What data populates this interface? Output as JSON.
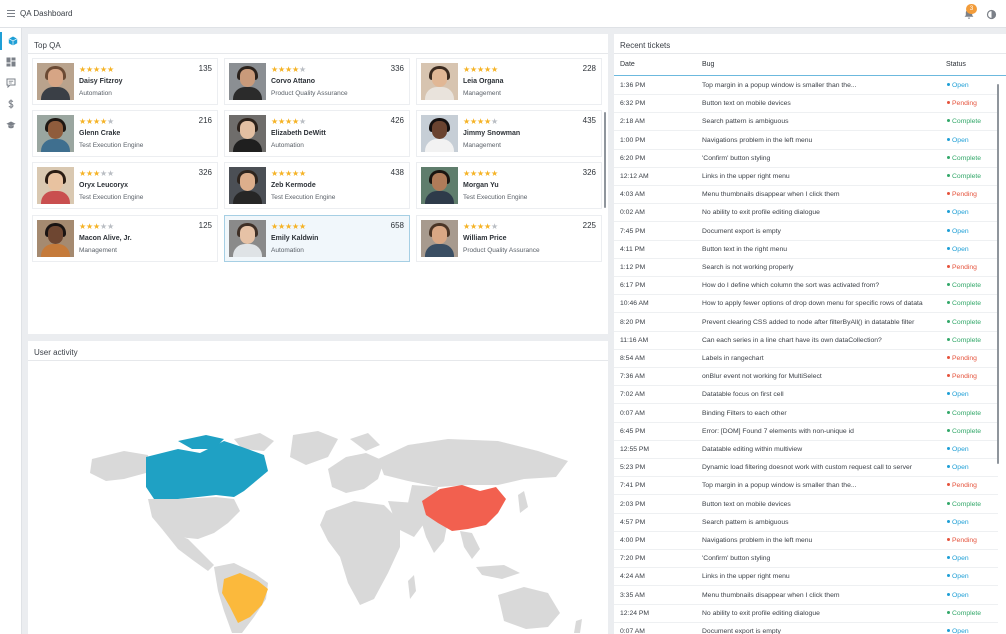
{
  "app": {
    "title": "QA Dashboard",
    "notifications": "3"
  },
  "colors": {
    "open": "#1f9fd6",
    "pending": "#e5533c",
    "complete": "#33a86a",
    "star": "#f5b326"
  },
  "sidenav": {
    "items": [
      {
        "name": "nav-dashboard",
        "icon": "cube-icon",
        "active": true
      },
      {
        "name": "nav-widgets",
        "icon": "grid-icon"
      },
      {
        "name": "nav-messages",
        "icon": "message-icon"
      },
      {
        "name": "nav-finance",
        "icon": "dollar-icon"
      },
      {
        "name": "nav-education",
        "icon": "graduation-cap-icon"
      }
    ]
  },
  "top_qa": {
    "title": "Top QA",
    "cards": [
      {
        "name": "Daisy Fitzroy",
        "role": "Automation",
        "count": "135",
        "rating": 5
      },
      {
        "name": "Corvo Attano",
        "role": "Product Quality Assurance",
        "count": "336",
        "rating": 4
      },
      {
        "name": "Leia Organa",
        "role": "Management",
        "count": "228",
        "rating": 5
      },
      {
        "name": "Glenn Crake",
        "role": "Test Execution Engine",
        "count": "216",
        "rating": 4
      },
      {
        "name": "Elizabeth DeWitt",
        "role": "Automation",
        "count": "426",
        "rating": 4
      },
      {
        "name": "Jimmy Snowman",
        "role": "Management",
        "count": "435",
        "rating": 4
      },
      {
        "name": "Oryx Leucoryx",
        "role": "Test Execution Engine",
        "count": "326",
        "rating": 3
      },
      {
        "name": "Zeb Kermode",
        "role": "Test Execution Engine",
        "count": "438",
        "rating": 5
      },
      {
        "name": "Morgan Yu",
        "role": "Test Execution Engine",
        "count": "326",
        "rating": 5
      },
      {
        "name": "Macon Alive, Jr.",
        "role": "Management",
        "count": "125",
        "rating": 3
      },
      {
        "name": "Emily Kaldwin",
        "role": "Automation",
        "count": "658",
        "rating": 5,
        "selected": true
      },
      {
        "name": "William Price",
        "role": "Product Quality Assurance",
        "count": "225",
        "rating": 4
      }
    ]
  },
  "user_activity": {
    "title": "User activity",
    "highlighted_countries": [
      "Canada",
      "China",
      "Brazil"
    ]
  },
  "tickets": {
    "title": "Recent tickets",
    "columns": [
      "Date",
      "Bug",
      "Status"
    ],
    "rows": [
      {
        "date": "1:36 PM",
        "bug": "Top margin in a popup window is smaller than the...",
        "status": "Open"
      },
      {
        "date": "6:32 PM",
        "bug": "Button text on mobile devices",
        "status": "Pending"
      },
      {
        "date": "2:18 AM",
        "bug": "Search pattern is ambiguous",
        "status": "Complete"
      },
      {
        "date": "1:00 PM",
        "bug": "Navigations problem in the left menu",
        "status": "Open"
      },
      {
        "date": "6:20 PM",
        "bug": "'Confirm' button styling",
        "status": "Complete"
      },
      {
        "date": "12:12 AM",
        "bug": "Links in the upper right menu",
        "status": "Complete"
      },
      {
        "date": "4:03 AM",
        "bug": "Menu thumbnails disappear when I click them",
        "status": "Pending"
      },
      {
        "date": "0:02 AM",
        "bug": "No ability to exit profile editing dialogue",
        "status": "Open"
      },
      {
        "date": "7:45 PM",
        "bug": "Document export is empty",
        "status": "Open"
      },
      {
        "date": "4:11 PM",
        "bug": "Button text in the right menu",
        "status": "Open"
      },
      {
        "date": "1:12 PM",
        "bug": "Search is not working properly",
        "status": "Pending"
      },
      {
        "date": "6:17 PM",
        "bug": "How do I define which column the sort was activated from?",
        "status": "Complete"
      },
      {
        "date": "10:46 AM",
        "bug": "How to apply fewer options of drop down menu for specific rows of datata",
        "status": "Complete"
      },
      {
        "date": "8:20 PM",
        "bug": "Prevent clearing CSS added to node after filterByAll() in datatable filter",
        "status": "Complete"
      },
      {
        "date": "11:16 AM",
        "bug": "Can each series in a line chart have its own dataCollection?",
        "status": "Complete"
      },
      {
        "date": "8:54 AM",
        "bug": "Labels in rangechart",
        "status": "Pending"
      },
      {
        "date": "7:36 AM",
        "bug": "onBlur event not working for MultiSelect",
        "status": "Pending"
      },
      {
        "date": "7:02 AM",
        "bug": "Datatable focus on first cell",
        "status": "Open"
      },
      {
        "date": "0:07 AM",
        "bug": "Binding Filters to each other",
        "status": "Complete"
      },
      {
        "date": "6:45 PM",
        "bug": "Error: [DOM] Found 7 elements with non-unique id",
        "status": "Complete"
      },
      {
        "date": "12:55 PM",
        "bug": "Datatable editing within multiview",
        "status": "Open"
      },
      {
        "date": "5:23 PM",
        "bug": "Dynamic load filtering doesnot work with custom request call to server",
        "status": "Open"
      },
      {
        "date": "7:41 PM",
        "bug": "Top margin in a popup window is smaller than the...",
        "status": "Pending"
      },
      {
        "date": "2:03 PM",
        "bug": "Button text on mobile devices",
        "status": "Complete"
      },
      {
        "date": "4:57 PM",
        "bug": "Search pattern is ambiguous",
        "status": "Open"
      },
      {
        "date": "4:00 PM",
        "bug": "Navigations problem in the left menu",
        "status": "Pending"
      },
      {
        "date": "7:20 PM",
        "bug": "'Confirm' button styling",
        "status": "Open"
      },
      {
        "date": "4:24 AM",
        "bug": "Links in the upper right menu",
        "status": "Open"
      },
      {
        "date": "3:35 AM",
        "bug": "Menu thumbnails disappear when I click them",
        "status": "Open"
      },
      {
        "date": "12:24 PM",
        "bug": "No ability to exit profile editing dialogue",
        "status": "Complete"
      },
      {
        "date": "0:07 AM",
        "bug": "Document export is empty",
        "status": "Open"
      }
    ]
  }
}
